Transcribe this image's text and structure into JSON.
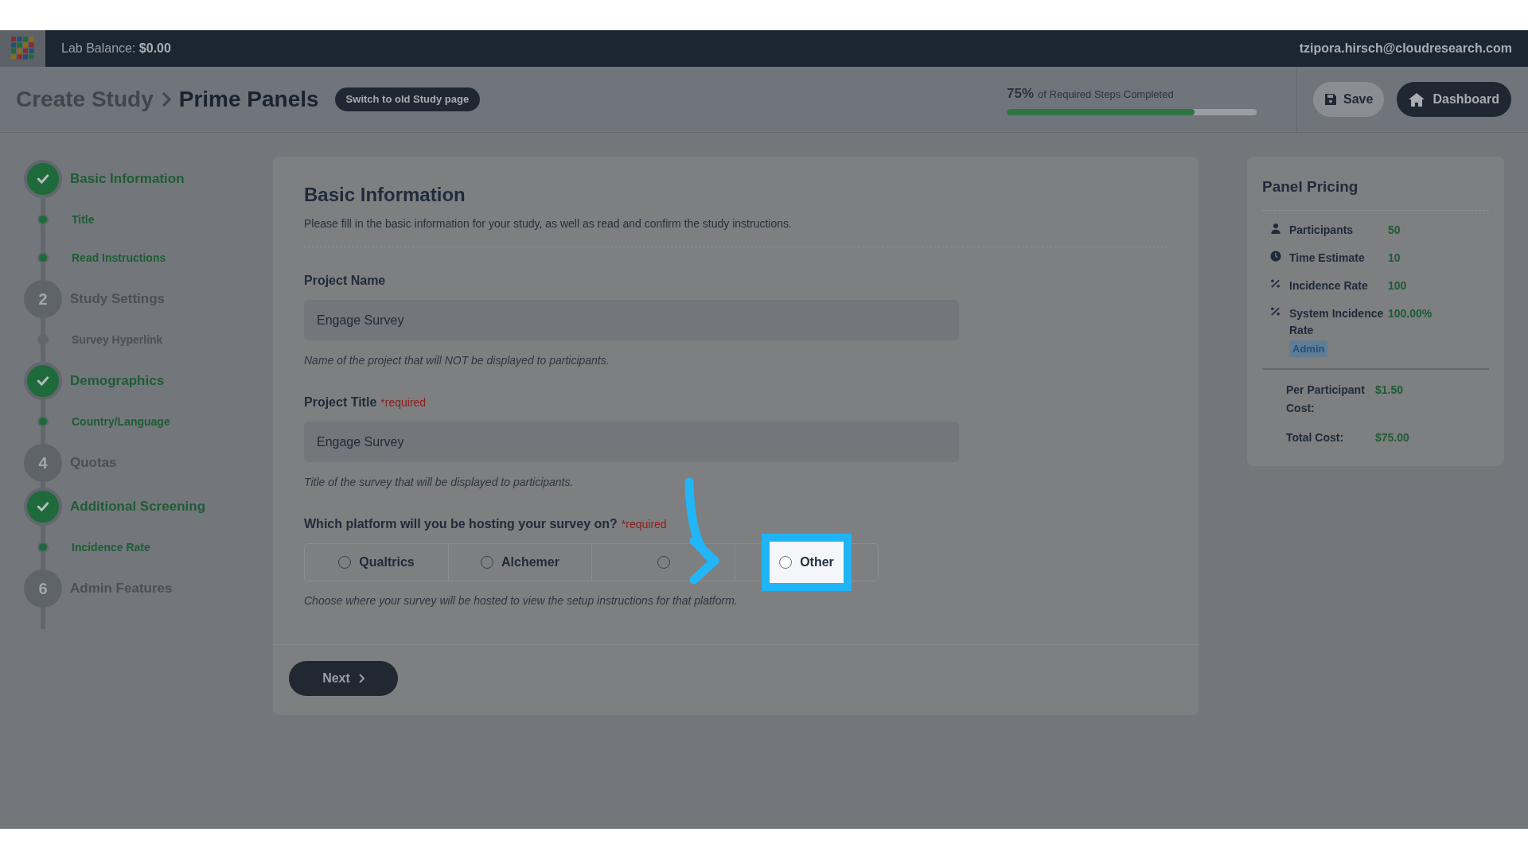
{
  "top_bar": {
    "balance_label": "Lab Balance:",
    "balance_value": "$0.00",
    "user_email": "tzipora.hirsch@cloudresearch.com"
  },
  "header": {
    "breadcrumb": [
      "Create Study",
      "Prime Panels"
    ],
    "switch_button": "Switch to old Study page",
    "progress": {
      "percent": "75%",
      "label": "of Required Steps Completed",
      "level": 0.75
    },
    "save_button": "Save",
    "dashboard_button": "Dashboard"
  },
  "steps": [
    {
      "done": true,
      "label": "Basic Information",
      "children": [
        {
          "label": "Title",
          "done": true
        },
        {
          "label": "Read Instructions",
          "done": true
        }
      ]
    },
    {
      "done": false,
      "number": "2",
      "label": "Study Settings",
      "children": [
        {
          "label": "Survey Hyperlink",
          "done": false
        }
      ]
    },
    {
      "done": true,
      "label": "Demographics",
      "children": [
        {
          "label": "Country/Language",
          "done": true
        }
      ]
    },
    {
      "done": false,
      "number": "4",
      "label": "Quotas"
    },
    {
      "done": true,
      "label": "Additional Screening",
      "children": [
        {
          "label": "Incidence Rate",
          "done": true
        }
      ]
    },
    {
      "done": false,
      "number": "6",
      "label": "Admin Features"
    }
  ],
  "form": {
    "title": "Basic Information",
    "description": "Please fill in the basic information for your study, as well as read and confirm the study instructions.",
    "fields": [
      {
        "label": "Project Name",
        "value": "Engage Survey",
        "hint": "Name of the project that will NOT be displayed to participants."
      },
      {
        "label": "Project Title",
        "required_note": "*required",
        "value": "Engage Survey",
        "hint": "Title of the survey that will be displayed to participants."
      }
    ],
    "platform": {
      "label": "Which platform will you be hosting your survey on?",
      "required_note": "*required",
      "hint": "Choose where your survey will be hosted to view the setup instructions for that platform.",
      "options": [
        {
          "label": "Qualtrics",
          "selected": false,
          "highlighted": false
        },
        {
          "label": "Alchemer",
          "selected": false,
          "highlighted": false
        },
        {
          "selected": false,
          "highlighted": false
        },
        {
          "label": "Other",
          "selected": false,
          "highlighted": true
        }
      ]
    },
    "next_button": "Next"
  },
  "pricing": {
    "title": "Panel Pricing",
    "rows": [
      {
        "kind": "person",
        "label": "Participants",
        "value": "50"
      },
      {
        "kind": "clock",
        "label": "Time Estimate",
        "value": "10"
      },
      {
        "kind": "percent",
        "label": "Incidence Rate",
        "value": "100"
      },
      {
        "kind": "percent",
        "label": "System Incidence Rate",
        "value": "100.00%",
        "badge": "Admin"
      }
    ],
    "costs": [
      {
        "label": "Per Participant Cost:",
        "value": "$1.50"
      },
      {
        "label": "Total Cost:",
        "value": "$75.00"
      }
    ]
  }
}
